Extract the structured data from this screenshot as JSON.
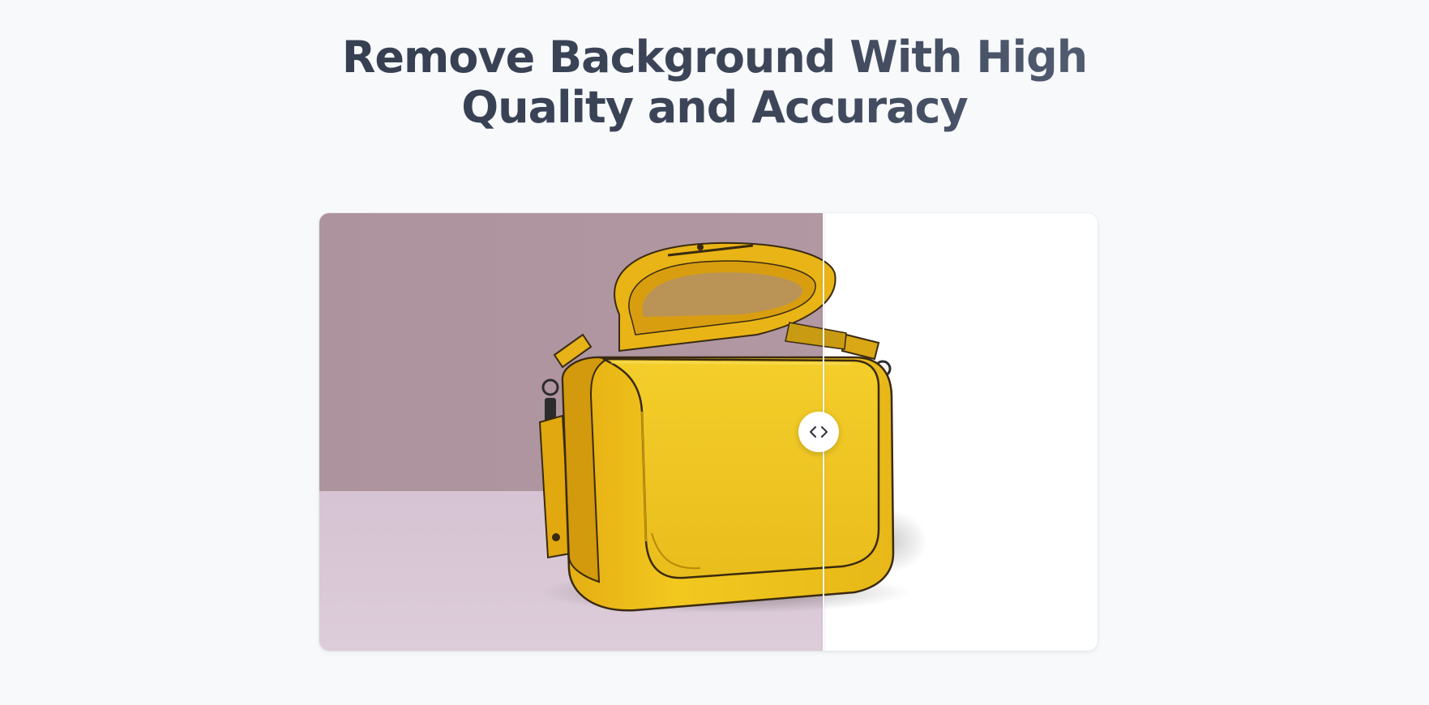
{
  "heading": {
    "line1": "Remove Background With High",
    "line2": "Quality and Accuracy"
  },
  "comparison": {
    "before_label": "original photo with mauve background",
    "after_label": "background removed",
    "slider_position_fraction": 0.647,
    "handle_icon": "chevrons-left-right-icon"
  },
  "colors": {
    "page_background": "#f7f9fb",
    "heading_text": "#3a4356",
    "backdrop_wall": "#b0959f",
    "backdrop_floor": "#d5c2d3",
    "bag_yellow": "#f0c21c",
    "removed_background": "#ffffff"
  }
}
